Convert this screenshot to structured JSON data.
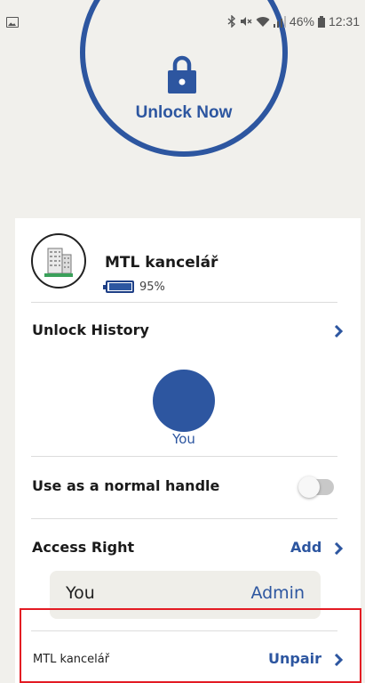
{
  "status_bar": {
    "battery": "46%",
    "time": "12:31",
    "icons": [
      "gallery-icon",
      "bluetooth-icon",
      "mute-icon",
      "wifi-icon",
      "signal-icon",
      "battery-icon"
    ]
  },
  "unlock": {
    "label": "Unlock Now",
    "icon": "lock-icon",
    "accent": "#2d56a0"
  },
  "device": {
    "name": "MTL kancelář",
    "battery_percent": "95%",
    "battery_level": 0.95,
    "icon": "building-icon"
  },
  "unlock_history": {
    "title": "Unlock History",
    "entries": [
      {
        "name": "You"
      }
    ]
  },
  "normal_handle": {
    "label": "Use as a normal handle",
    "enabled": false
  },
  "access_right": {
    "title": "Access Right",
    "add_label": "Add",
    "users": [
      {
        "name": "You",
        "role": "Admin"
      }
    ]
  },
  "pairing": {
    "device_label": "MTL kancelář",
    "unpair_label": "Unpair"
  },
  "colors": {
    "accent": "#2d56a0",
    "background": "#f1f0ec",
    "highlight": "#e31b23"
  }
}
